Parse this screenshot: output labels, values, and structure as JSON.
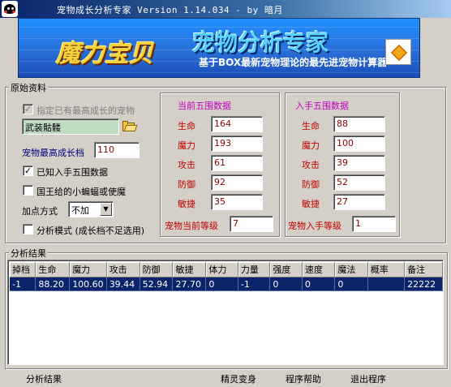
{
  "window": {
    "title": "宠物成长分析专家 Version 1.14.034 - by 暗月"
  },
  "banner": {
    "logo_text": "魔力宝贝",
    "product_name": "宠物分析专家",
    "slogan": "基于BOX最新宠物理论的最先进宠物计算器"
  },
  "original": {
    "group_label": "原始资料",
    "specify_max_growth_label": "指定已有最高成长的宠物",
    "specify_max_growth_checked": true,
    "pet_name": "武装骷髅",
    "max_growth_label": "宠物最高成长档",
    "max_growth_value": "110",
    "known_stats_label": "已知入手五围数据",
    "known_stats_checked": true,
    "king_bat_label": "国王给的小蝙蝠或使魔",
    "king_bat_checked": false,
    "add_point_label": "加点方式",
    "add_point_value": "不加",
    "analysis_mode_label": "分析模式 (成长档不足选用)",
    "analysis_mode_checked": false
  },
  "current": {
    "title": "当前五围数据",
    "stats": [
      {
        "label": "生命",
        "value": "164"
      },
      {
        "label": "魔力",
        "value": "193"
      },
      {
        "label": "攻击",
        "value": "61"
      },
      {
        "label": "防御",
        "value": "92"
      },
      {
        "label": "敏捷",
        "value": "35"
      }
    ],
    "level_label": "宠物当前等级",
    "level_value": "7"
  },
  "initial": {
    "title": "入手五围数据",
    "stats": [
      {
        "label": "生命",
        "value": "88"
      },
      {
        "label": "魔力",
        "value": "100"
      },
      {
        "label": "攻击",
        "value": "39"
      },
      {
        "label": "防御",
        "value": "52"
      },
      {
        "label": "敏捷",
        "value": "27"
      }
    ],
    "level_label": "宠物入手等级",
    "level_value": "1"
  },
  "results": {
    "group_label": "分析结果",
    "columns": [
      "掉档",
      "生命",
      "魔力",
      "攻击",
      "防御",
      "敏捷",
      "体力",
      "力量",
      "强度",
      "速度",
      "魔法",
      "概率",
      "备注"
    ],
    "rows": [
      [
        "-1",
        "88.20",
        "100.60",
        "39.44",
        "52.94",
        "27.70",
        "0",
        "-1",
        "0",
        "0",
        "0",
        "",
        "22222"
      ]
    ]
  },
  "menu": {
    "analysis": "分析结果",
    "elf_transform": "精灵变身",
    "help": "程序帮助",
    "exit": "退出程序"
  },
  "colors": {
    "title_gradient_start": "#0a246a",
    "stat_label": "#c00000",
    "section_title": "#c000c0",
    "selected_row": "#0a246a"
  },
  "icons": [
    "app-icon",
    "folder-open-icon",
    "box-icon",
    "checkmark-icon",
    "dropdown-arrow-icon"
  ]
}
